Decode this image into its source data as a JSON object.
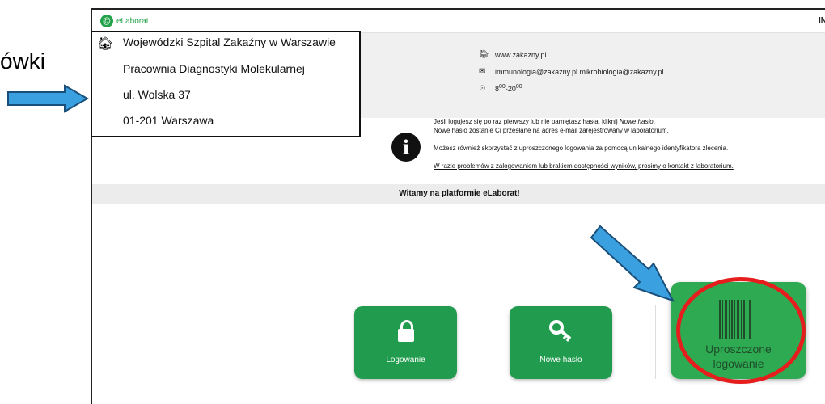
{
  "annotation": {
    "left_text": "ówki"
  },
  "app": {
    "logo_text": "eLaborat",
    "logo_symbol": "@",
    "topright_text": "IN"
  },
  "contact": {
    "website": "www.zakazny.pl",
    "emails": "immunologia@zakazny.pl mikrobiologia@zakazny.pl",
    "hours_from": "8",
    "hours_from_sup": "00",
    "hours_sep": "-",
    "hours_to": "20",
    "hours_to_sup": "00"
  },
  "address": {
    "line1": "Wojewódzki Szpital Zakaźny w Warszawie",
    "line2": "Pracownia Diagnostyki Molekularnej",
    "line3": "ul. Wolska 37",
    "line4": "01-201 Warszawa"
  },
  "info": {
    "p1_prefix": "Jeśli logujesz się po raz pierwszy lub nie pamiętasz hasła, kliknij ",
    "p1_link": "Nowe hasło",
    "p1_suffix": ".",
    "p2": "Nowe hasło zostanie Ci przesłane na adres e-mail zarejestrowany w laboratorium.",
    "p3": "Możesz również skorzystać z uproszczonego logowania za pomocą unikalnego identyfikatora zlecenia.",
    "p4": "W razie problemów z zalogowaniem lub brakiem dostępności wyników, prosimy o kontakt z laboratorium."
  },
  "welcome": "Witamy na platformie eLaborat!",
  "tiles": {
    "login": "Logowanie",
    "new_password": "Nowe hasło",
    "simplified_1": "Uproszczone",
    "simplified_2": "logowanie"
  },
  "colors": {
    "brand_green": "#219c4e",
    "annotation_blue": "#3aa0e0",
    "highlight_red": "#e61d1d"
  }
}
